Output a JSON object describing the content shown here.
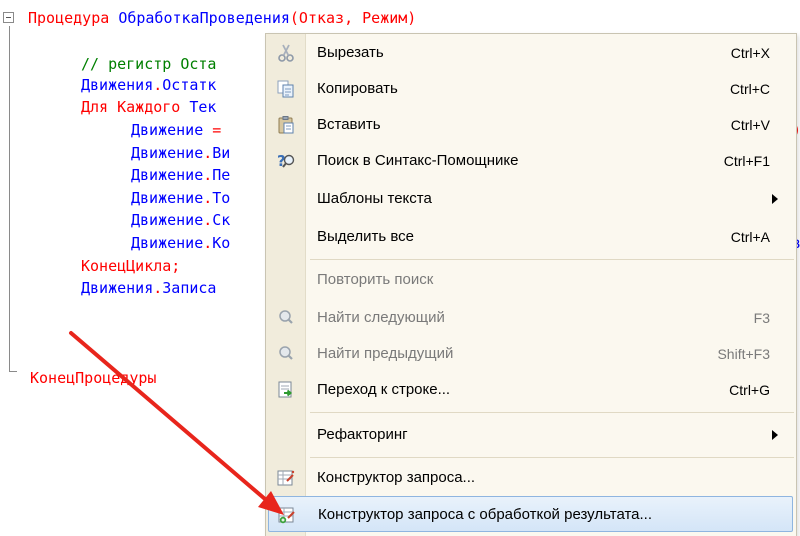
{
  "editor": {
    "lines": [
      {
        "kw": "Процедура ",
        "id": "ОбработкаПроведения",
        "pu": "(Отказ, Режим)"
      },
      {
        "cm": "// регистр Оста"
      },
      {
        "id": "Движения",
        "pu": ".",
        "id2": "Остатк"
      },
      {
        "kw": "Для Каждого ",
        "id": "Тек"
      },
      {
        "id": "Движение",
        "pu": " ="
      },
      {
        "id": "Движение",
        "pu": ".",
        "id2": "Ви"
      },
      {
        "id": "Движение",
        "pu": ".",
        "id2": "Пе"
      },
      {
        "id": "Движение",
        "pu": ".",
        "id2": "То"
      },
      {
        "id": "Движение",
        "pu": ".",
        "id2": "Ск"
      },
      {
        "id": "Движение",
        "pu": ".",
        "id2": "Ко"
      },
      {
        "kw": "КонецЦикла;"
      },
      {
        "id": "Движения",
        "pu": ".",
        "id2": "Записа"
      },
      {
        "kw": "КонецПроцедуры"
      }
    ],
    "clipped_right": [
      ")",
      "в"
    ]
  },
  "menu": {
    "items": [
      {
        "label": "Вырезать",
        "shortcut": "Ctrl+X",
        "icon": "scissors-icon",
        "disabled": false
      },
      {
        "label": "Копировать",
        "shortcut": "Ctrl+C",
        "icon": "copy-icon",
        "disabled": false
      },
      {
        "label": "Вставить",
        "shortcut": "Ctrl+V",
        "icon": "paste-icon",
        "disabled": false
      },
      {
        "label": "Поиск в Синтакс-Помощнике",
        "shortcut": "Ctrl+F1",
        "icon": "help-search-icon",
        "disabled": false
      },
      {
        "label": "Шаблоны текста",
        "shortcut": "",
        "icon": "",
        "submenu": true,
        "disabled": false
      },
      {
        "label": "Выделить все",
        "shortcut": "Ctrl+A",
        "icon": "",
        "disabled": false
      },
      {
        "label": "Повторить поиск",
        "shortcut": "",
        "icon": "",
        "disabled": true
      },
      {
        "label": "Найти следующий",
        "shortcut": "F3",
        "icon": "find-next-icon",
        "disabled": true
      },
      {
        "label": "Найти предыдущий",
        "shortcut": "Shift+F3",
        "icon": "find-previous-icon",
        "disabled": true
      },
      {
        "label": "Переход к строке...",
        "shortcut": "Ctrl+G",
        "icon": "goto-line-icon",
        "disabled": false
      },
      {
        "label": "Рефакторинг",
        "shortcut": "",
        "icon": "",
        "submenu": true,
        "disabled": false
      },
      {
        "label": "Конструктор запроса...",
        "shortcut": "",
        "icon": "query-builder-icon",
        "disabled": false
      },
      {
        "label": "Конструктор запроса с обработкой результата...",
        "shortcut": "",
        "icon": "query-builder-result-icon",
        "disabled": false,
        "highlighted": true
      }
    ]
  },
  "colors": {
    "keyword": "#ff0000",
    "identifier": "#0000ff",
    "comment": "#008000",
    "menu_background": "#fbf8ef",
    "highlight": "#d4e5f7",
    "annotation_arrow": "#e8251c"
  }
}
